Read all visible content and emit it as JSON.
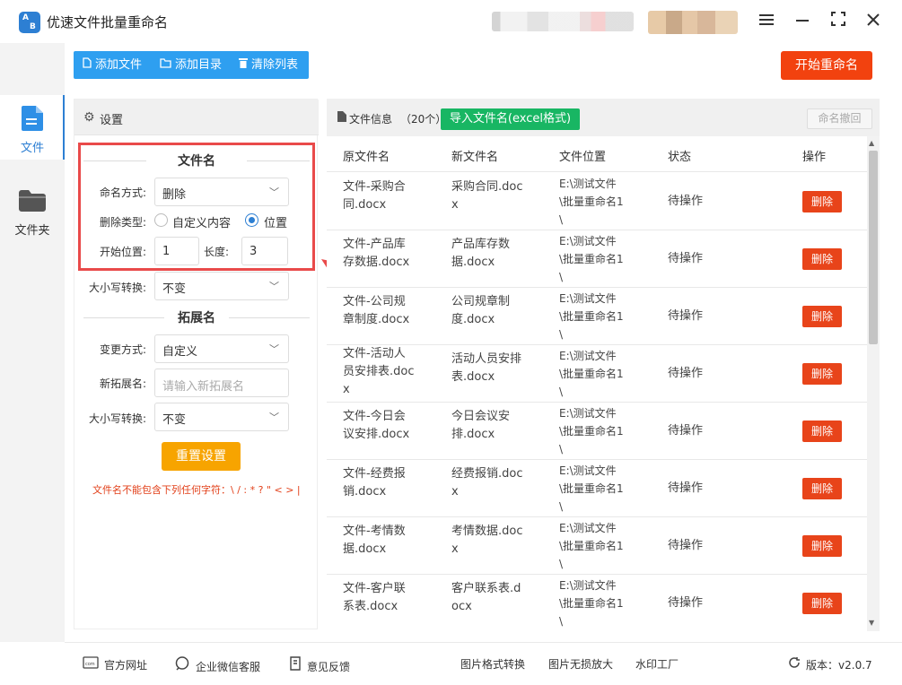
{
  "app": {
    "title": "优速文件批量重命名"
  },
  "window": {
    "menu_icon": "hamburger-icon",
    "min_icon": "minimize-icon",
    "max_icon": "maximize-icon",
    "close_icon": "close-icon"
  },
  "rail": {
    "items": [
      {
        "label": "文件",
        "icon": "file-icon",
        "active": true
      },
      {
        "label": "文件夹",
        "icon": "folder-icon",
        "active": false
      }
    ]
  },
  "toolbar": {
    "add_file": "添加文件",
    "add_dir": "添加目录",
    "clear_list": "清除列表",
    "start": "开始重命名"
  },
  "settings": {
    "header": "设置",
    "filename_section": "文件名",
    "naming_mode_label": "命名方式:",
    "naming_mode_value": "删除",
    "delete_type_label": "删除类型:",
    "delete_type_options": [
      "自定义内容",
      "位置"
    ],
    "delete_type_selected": "位置",
    "start_pos_label": "开始位置:",
    "start_pos_value": "1",
    "length_label": "长度:",
    "length_value": "3",
    "case_label": "大小写转换:",
    "case_value": "不变",
    "ext_section": "拓展名",
    "change_mode_label": "变更方式:",
    "change_mode_value": "自定义",
    "new_ext_label": "新拓展名:",
    "new_ext_placeholder": "请输入新拓展名",
    "ext_case_label": "大小写转换:",
    "ext_case_value": "不变",
    "reset": "重置设置",
    "warning": "文件名不能包含下列任何字符：\\ / : * ? \" < > |"
  },
  "files": {
    "header": "文件信息",
    "count": "（20个）",
    "import_btn": "导入文件名(excel格式)",
    "undo_btn": "命名撤回",
    "columns": [
      "原文件名",
      "新文件名",
      "文件位置",
      "状态",
      "操作"
    ],
    "rows": [
      {
        "orig": "文件-采购合\n同.docx",
        "new": "采购合同.doc\nx",
        "loc": "E:\\测试文件\n\\批量重命名1\n\\",
        "status": "待操作",
        "action": "删除"
      },
      {
        "orig": "文件-产品库\n存数据.docx",
        "new": "产品库存数\n据.docx",
        "loc": "E:\\测试文件\n\\批量重命名1\n\\",
        "status": "待操作",
        "action": "删除"
      },
      {
        "orig": "文件-公司规\n章制度.docx",
        "new": "公司规章制\n度.docx",
        "loc": "E:\\测试文件\n\\批量重命名1\n\\",
        "status": "待操作",
        "action": "删除"
      },
      {
        "orig": "文件-活动人\n员安排表.doc\nx",
        "new": "活动人员安排\n表.docx",
        "loc": "E:\\测试文件\n\\批量重命名1\n\\",
        "status": "待操作",
        "action": "删除"
      },
      {
        "orig": "文件-今日会\n议安排.docx",
        "new": "今日会议安\n排.docx",
        "loc": "E:\\测试文件\n\\批量重命名1\n\\",
        "status": "待操作",
        "action": "删除"
      },
      {
        "orig": "文件-经费报\n销.docx",
        "new": "经费报销.doc\nx",
        "loc": "E:\\测试文件\n\\批量重命名1\n\\",
        "status": "待操作",
        "action": "删除"
      },
      {
        "orig": "文件-考情数\n据.docx",
        "new": "考情数据.doc\nx",
        "loc": "E:\\测试文件\n\\批量重命名1\n\\",
        "status": "待操作",
        "action": "删除"
      },
      {
        "orig": "文件-客户联\n系表.docx",
        "new": "客户联系表.d\nocx",
        "loc": "E:\\测试文件\n\\批量重命名1\n\\",
        "status": "待操作",
        "action": "删除"
      }
    ]
  },
  "footer": {
    "website": "官方网址",
    "wechat": "企业微信客服",
    "feedback": "意见反馈",
    "img_convert": "图片格式转换",
    "img_enlarge": "图片无损放大",
    "watermark": "水印工厂",
    "version_label": "版本：",
    "version": "v2.0.7"
  },
  "colors": {
    "accent": "#2e9ff0",
    "start": "#f2420f",
    "delete": "#e8441a",
    "import": "#18b663",
    "reset": "#f7a400",
    "highlight": "#e94a4a"
  }
}
